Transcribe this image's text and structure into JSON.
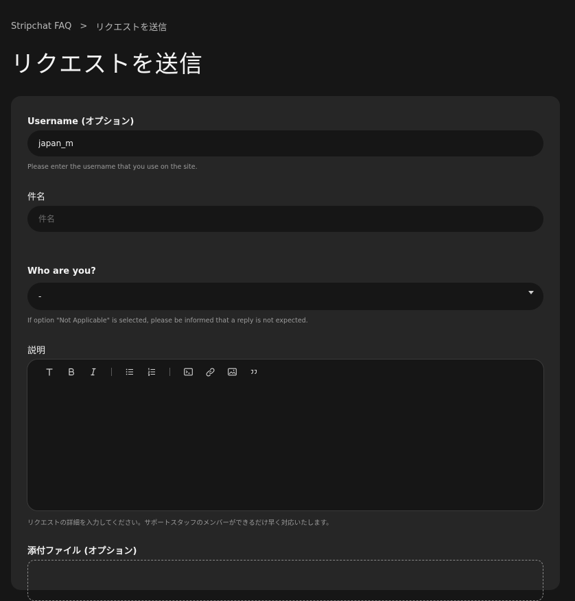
{
  "breadcrumb": {
    "root": "Stripchat FAQ",
    "separator": ">",
    "current": "リクエストを送信"
  },
  "page": {
    "title": "リクエストを送信"
  },
  "form": {
    "username": {
      "label": "Username (オプション)",
      "value": "japan_m",
      "hint": "Please enter the username that you use on the site."
    },
    "subject": {
      "label": "件名",
      "placeholder": "件名"
    },
    "who": {
      "label": "Who are you?",
      "selected": "-",
      "hint": "If option \"Not Applicable\" is selected, please be informed that a reply is not expected."
    },
    "description": {
      "label": "説明",
      "hint": "リクエストの詳細を入力してください。サポートスタッフのメンバーができるだけ早く対応いたします。",
      "toolbar": [
        "text-style-icon",
        "bold-icon",
        "italic-icon",
        "bulleted-list-icon",
        "numbered-list-icon",
        "code-block-icon",
        "link-icon",
        "image-icon",
        "quote-icon"
      ]
    },
    "attachments": {
      "label": "添付ファイル (オプション)"
    }
  },
  "colors": {
    "background": "#161616",
    "card": "#262626",
    "field": "#161616",
    "text": "#ffffff",
    "muted": "#9c9c9c"
  }
}
